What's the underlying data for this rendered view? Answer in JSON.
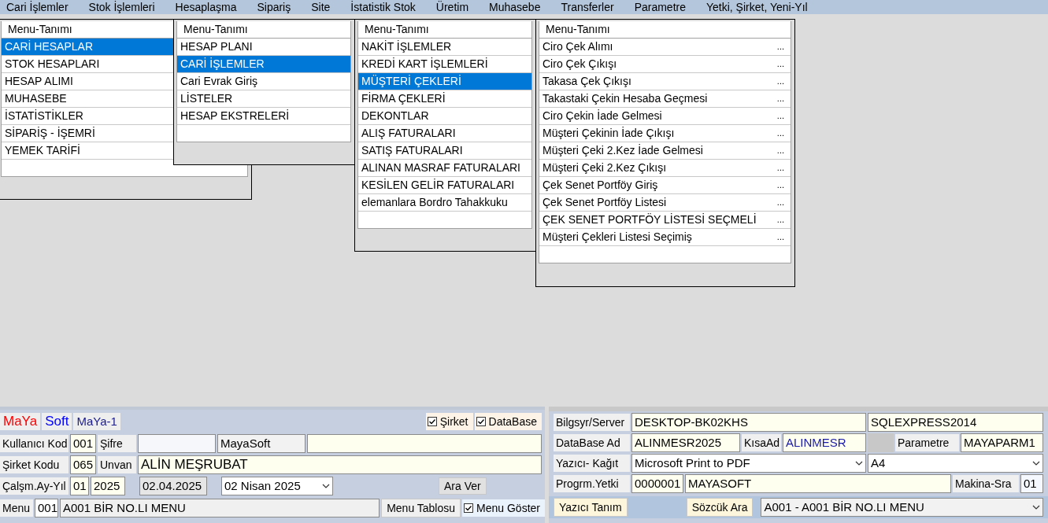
{
  "menubar": [
    {
      "label": "Cari İşlemler"
    },
    {
      "label": "Stok İşlemleri"
    },
    {
      "label": "Hesaplaşma"
    },
    {
      "label": "Sipariş"
    },
    {
      "label": "Site"
    },
    {
      "label": "İstatistik Stok"
    },
    {
      "label": "Üretim"
    },
    {
      "label": "Muhasebe"
    },
    {
      "label": "Transferler"
    },
    {
      "label": "Parametre"
    },
    {
      "label": "Yetki, Şirket, Yeni-Yıl"
    }
  ],
  "menus": [
    {
      "header": "Menu-Tanımı",
      "items": [
        {
          "label": "CARİ HESAPLAR",
          "selected": true
        },
        {
          "label": "STOK HESAPLARI",
          "selected": false
        },
        {
          "label": "HESAP ALIMI",
          "selected": false
        },
        {
          "label": "MUHASEBE",
          "selected": false
        },
        {
          "label": "İSTATİSTİKLER",
          "selected": false
        },
        {
          "label": "SİPARİŞ - İŞEMRİ",
          "selected": false
        },
        {
          "label": "YEMEK TARİFİ",
          "selected": false
        }
      ]
    },
    {
      "header": "Menu-Tanımı",
      "items": [
        {
          "label": "HESAP PLANI",
          "selected": false
        },
        {
          "label": "CARİ İŞLEMLER",
          "selected": true
        },
        {
          "label": "Cari Evrak Giriş",
          "selected": false
        },
        {
          "label": "LİSTELER",
          "selected": false
        },
        {
          "label": "HESAP EKSTRELERİ",
          "selected": false
        }
      ]
    },
    {
      "header": "Menu-Tanımı",
      "items": [
        {
          "label": "NAKİT İŞLEMLER",
          "selected": false
        },
        {
          "label": "KREDİ KART İŞLEMLERİ",
          "selected": false
        },
        {
          "label": "MÜŞTERİ ÇEKLERİ",
          "selected": true
        },
        {
          "label": "FİRMA  ÇEKLERİ",
          "selected": false
        },
        {
          "label": "DEKONTLAR",
          "selected": false
        },
        {
          "label": "ALIŞ FATURALARI",
          "selected": false
        },
        {
          "label": "SATIŞ FATURALARI",
          "selected": false
        },
        {
          "label": "ALINAN MASRAF FATURALARI",
          "selected": false
        },
        {
          "label": "KESİLEN GELİR FATURALARI",
          "selected": false
        },
        {
          "label": "elemanlara Bordro Tahakkuku",
          "selected": false
        }
      ]
    },
    {
      "header": "Menu-Tanımı",
      "items": [
        {
          "label": "Ciro Çek Alımı",
          "selected": false,
          "more": "..."
        },
        {
          "label": "Ciro Çek Çıkışı",
          "selected": false,
          "more": "..."
        },
        {
          "label": "Takasa Çek Çıkışı",
          "selected": false,
          "more": "..."
        },
        {
          "label": "Takastaki Çekin Hesaba Geçmesi",
          "selected": false,
          "more": "..."
        },
        {
          "label": "Ciro Çekin İade Gelmesi",
          "selected": false,
          "more": "..."
        },
        {
          "label": "Müşteri Çekinin İade Çıkışı",
          "selected": false,
          "more": "..."
        },
        {
          "label": "Müşteri Çeki 2.Kez İade Gelmesi",
          "selected": false,
          "more": "..."
        },
        {
          "label": "Müşteri Çeki 2.Kez Çıkışı",
          "selected": false,
          "more": "..."
        },
        {
          "label": "Çek Senet Portföy Giriş",
          "selected": false,
          "more": "..."
        },
        {
          "label": "Çek Senet Portföy Listesi",
          "selected": false,
          "more": "..."
        },
        {
          "label": "ÇEK SENET PORTFÖY LİSTESİ SEÇMELİ",
          "selected": false,
          "more": "..."
        },
        {
          "label": "Müşteri Çekleri Listesi Seçimiş",
          "selected": false,
          "more": "..."
        }
      ]
    }
  ],
  "login": {
    "brand": [
      {
        "text": "MaYa",
        "color": "#ff0000"
      },
      {
        "text": "Soft",
        "color": "#0000ff"
      },
      {
        "text": "MaYa-1",
        "color": "#1a1a8c"
      }
    ],
    "options": [
      {
        "label": "Şirket",
        "checked": true
      },
      {
        "label": "DataBase",
        "checked": true
      }
    ],
    "user_label": "Kullanıcı Kod",
    "user_code": "001",
    "password_label": "Şifre",
    "user_name": "MayaSoft",
    "company_label": "Şirket Kodu",
    "company_code": "065",
    "title_label": "Unvan",
    "title": "ALİN MEŞRUBAT",
    "period_label": "Çalşm.Ay-Yıl",
    "month": "01",
    "year": "2025",
    "date": "02.04.2025",
    "period_select": "02   Nisan   2025",
    "pause_button": "Ara Ver",
    "menu_label": "Menu",
    "menu_code": "001",
    "menu_name": "A001  BİR NO.LI MENU",
    "menu_table_button": "Menu Tablosu",
    "show_menu": {
      "label": "Menu Göster",
      "checked": true
    }
  },
  "server": {
    "server_label": "Bilgsyr/Server",
    "computer": "DESKTOP-BK02KHS",
    "instance": "SQLEXPRESS2014",
    "db_label": "DataBase Ad",
    "db_name": "ALINMESR2025",
    "short_label": "KısaAd",
    "short_name": "ALINMESR",
    "param_label": "Parametre",
    "param": "MAYAPARM1",
    "printer_label": "Yazıcı- Kağıt",
    "printer": "Microsoft Print to PDF",
    "paper": "A4",
    "auth_label": "Progrm.Yetki",
    "auth_code": "0000001",
    "auth_name": "MAYASOFT",
    "machine_label": "Makina-Sra",
    "machine": "01",
    "printer_button": "Yazıcı Tanım",
    "word_button": "Sözcük Ara",
    "menu_select": "A001 - A001  BİR NO.LI MENU"
  }
}
